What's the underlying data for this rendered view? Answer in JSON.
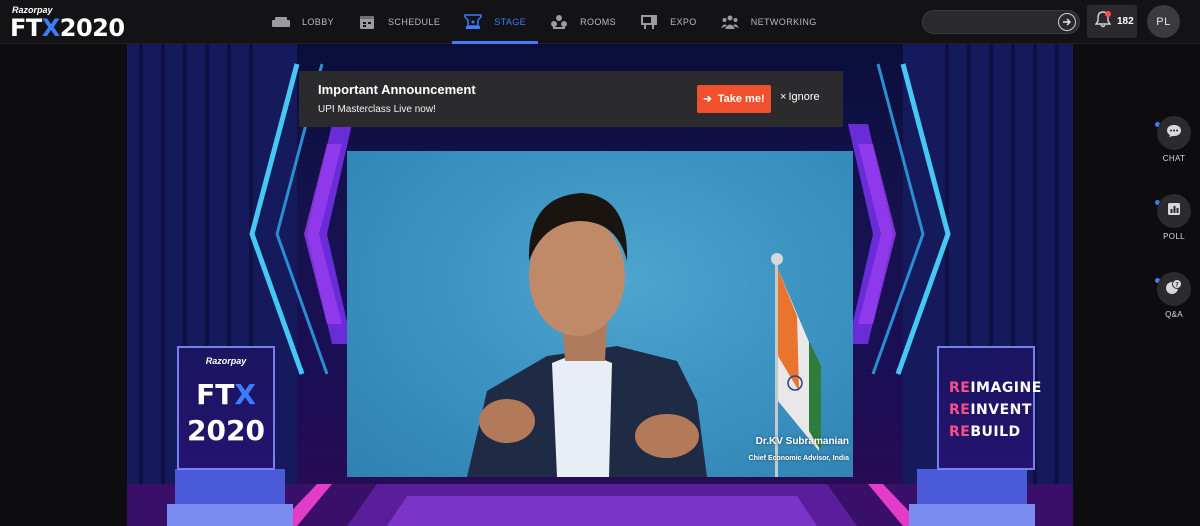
{
  "brand": {
    "company": "Razorpay",
    "event_prefix": "FT",
    "event_x": "X",
    "event_year": "2020"
  },
  "nav": {
    "items": [
      {
        "label": "LOBBY",
        "icon": "sofa-icon",
        "active": false
      },
      {
        "label": "SCHEDULE",
        "icon": "calendar-icon",
        "active": false
      },
      {
        "label": "STAGE",
        "icon": "stage-icon",
        "active": true
      },
      {
        "label": "ROOMS",
        "icon": "rooms-icon",
        "active": false
      },
      {
        "label": "EXPO",
        "icon": "expo-icon",
        "active": false
      },
      {
        "label": "NETWORKING",
        "icon": "networking-icon",
        "active": false
      }
    ],
    "accent": "#3d7bff"
  },
  "search": {
    "value": "",
    "placeholder": ""
  },
  "notifications": {
    "count": "182"
  },
  "user": {
    "initials": "PL"
  },
  "announcement": {
    "title": "Important Announcement",
    "subtitle": "UPI Masterclass Live now!",
    "primary_label": "Take me!",
    "secondary_label": "Ignore",
    "primary_color": "#f0502e"
  },
  "speaker": {
    "name": "Dr.KV Subramanian",
    "role": "Chief Economic Advisor, India"
  },
  "stage_panels": {
    "left": {
      "company": "Razorpay",
      "prefix": "FT",
      "x": "X",
      "year": "2020"
    },
    "right": {
      "lines": [
        {
          "r": "RE",
          "rest": "IMAGINE"
        },
        {
          "r": "RE",
          "rest": "INVENT"
        },
        {
          "r": "RE",
          "rest": "BUILD"
        }
      ]
    }
  },
  "rail": {
    "items": [
      {
        "label": "CHAT",
        "icon": "chat-icon"
      },
      {
        "label": "POLL",
        "icon": "poll-icon"
      },
      {
        "label": "Q&A",
        "icon": "qa-icon"
      }
    ]
  }
}
